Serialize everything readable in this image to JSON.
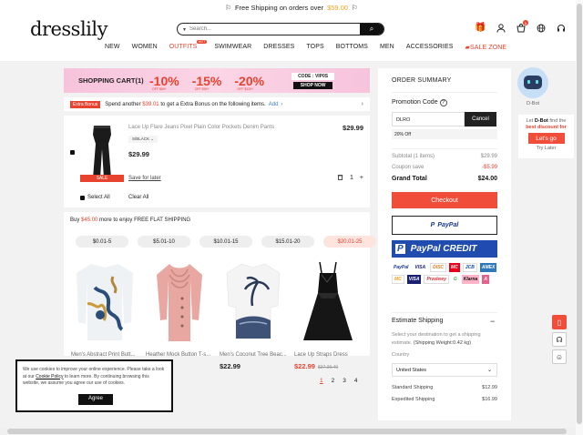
{
  "topbar": {
    "text": "Free Shipping on orders over",
    "price": "$59.00"
  },
  "header": {
    "logo": "dresslily",
    "search_placeholder": "Search...",
    "nav": [
      "NEW",
      "WOMEN",
      "OUTFITS",
      "SWIMWEAR",
      "DRESSES",
      "TOPS",
      "BOTTOMS",
      "MEN",
      "ACCESSORIES",
      "SALE ZONE"
    ],
    "hot_badge": "HOT",
    "cart_count": "1"
  },
  "cart": {
    "banner_title": "SHOPPING CART(1)",
    "discounts": [
      {
        "pct": "-10%",
        "note": "OFF $69+"
      },
      {
        "pct": "-15%",
        "note": "OFF $99+"
      },
      {
        "pct": "-20%",
        "note": "OFF $129+"
      }
    ],
    "code": "CODE : VIP0S",
    "shop_now": "SHOP NOW",
    "bonus_tag": "Extra Bonus",
    "bonus_text_1": "Spend another",
    "bonus_amount": "$39.01",
    "bonus_text_2": "to get a Extra Bonus on the following items.",
    "bonus_add": "Add",
    "item": {
      "name": "Lace Up Flare Jeans Pixel Plain Color Pockets Denim Pants",
      "price_right": "$29.99",
      "variant": "S/BLACK",
      "price": "$29.99",
      "badge": "SALE",
      "save_later": "Save for later",
      "qty": "1"
    },
    "select_all": "Select All",
    "clear_all": "Clear All"
  },
  "flat": {
    "text_1": "Buy",
    "amount": "$45.00",
    "text_2": "more to enjoy FREE FLAT SHIPPING",
    "tabs": [
      "$0.01-5",
      "$5.01-10",
      "$10.01-15",
      "$15.01-20",
      "$20.01-25"
    ],
    "products": [
      {
        "name": "Men's Abstract Print Butt...",
        "price": "",
        "old": ""
      },
      {
        "name": "Heather Mock Button T-s...",
        "price": "",
        "old": ""
      },
      {
        "name": "Men's Coconut Tree Beac...",
        "price": "$22.99",
        "old": ""
      },
      {
        "name": "Lace Up Straps Dress",
        "price": "$22.99",
        "old": "$37.39.40"
      }
    ],
    "pages": [
      "1",
      "2",
      "3",
      "4"
    ]
  },
  "summary": {
    "title": "ORDER SUMMARY",
    "promo_label": "Promotion Code",
    "promo_value": "DLRO",
    "cancel": "Cancel",
    "off": "20% Off",
    "subtotal_label": "Subtotal (1 items)",
    "subtotal": "$29.99",
    "coupon_label": "Coupon save",
    "coupon": "-$5.99",
    "total_label": "Grand Total",
    "total": "$24.00",
    "checkout": "Checkout",
    "paypal": "PayPal",
    "paypal_credit": "PayPal CREDIT",
    "cards": [
      "PayPal",
      "VISA",
      "DISC",
      "MC",
      "JCB",
      "AMEX",
      "MC",
      "VISA",
      "Przelewy",
      "G",
      "Klarna",
      "A"
    ],
    "est_title": "Estimate Shipping",
    "est_desc": "Select your destination to get a shipping estimate.",
    "est_weight": "(Shipping Weight:0.42 kg)",
    "country_label": "Country",
    "country": "United States",
    "standard_label": "Standard Shipping",
    "standard": "$12.99",
    "expedited_label": "Expedited Shipping",
    "expedited": "$16.99"
  },
  "dbot": {
    "name": "D-Bot",
    "text_1": "Let",
    "brand": "D-Bot",
    "text_2": "find the",
    "best": "best discount for",
    "go": "Let's go",
    "later": "Try Later"
  },
  "cookie": {
    "text_1": "We use cookies to improve your online experience. Please take a look at our",
    "link": "Cookie Policy",
    "text_2": "to learn more. By continuing browsing this website, we assume you agree our use of cookies.",
    "agree": "Agree"
  }
}
